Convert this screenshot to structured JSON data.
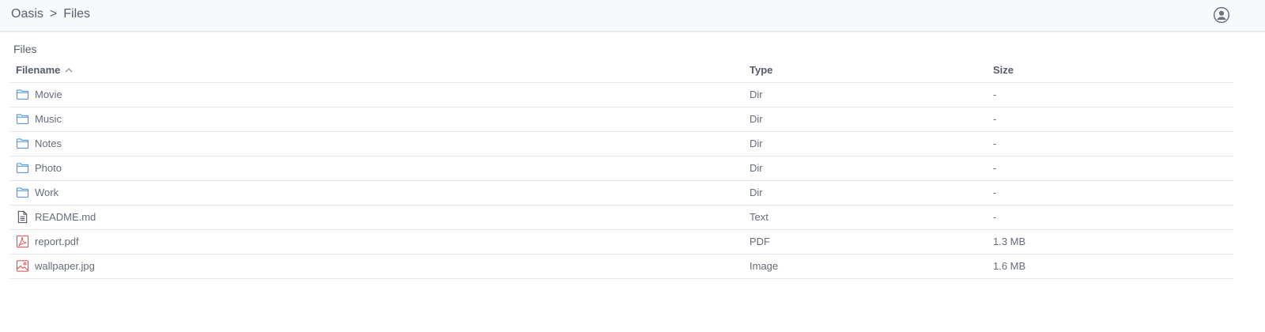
{
  "header": {
    "breadcrumb": [
      "Oasis",
      "Files"
    ],
    "separator": ">",
    "user_icon": "user-circle-icon"
  },
  "section": {
    "title": "Files"
  },
  "table": {
    "columns": [
      {
        "label": "Filename",
        "sort": "ascending"
      },
      {
        "label": "Type"
      },
      {
        "label": "Size"
      }
    ],
    "rows": [
      {
        "icon": "folder-icon",
        "name": "Movie",
        "type": "Dir",
        "size": "-"
      },
      {
        "icon": "folder-icon",
        "name": "Music",
        "type": "Dir",
        "size": "-"
      },
      {
        "icon": "folder-icon",
        "name": "Notes",
        "type": "Dir",
        "size": "-"
      },
      {
        "icon": "folder-icon",
        "name": "Photo",
        "type": "Dir",
        "size": "-"
      },
      {
        "icon": "folder-icon",
        "name": "Work",
        "type": "Dir",
        "size": "-"
      },
      {
        "icon": "text-file-icon",
        "name": "README.md",
        "type": "Text",
        "size": "-"
      },
      {
        "icon": "pdf-file-icon",
        "name": "report.pdf",
        "type": "PDF",
        "size": "1.3 MB"
      },
      {
        "icon": "image-file-icon",
        "name": "wallpaper.jpg",
        "type": "Image",
        "size": "1.6 MB"
      }
    ]
  },
  "colors": {
    "folder": "#3b8ef0",
    "text_file": "#444a55",
    "pdf": "#e64545",
    "image": "#e64545",
    "header_bg": "#f8f9fb",
    "border": "#e6e8ec"
  }
}
